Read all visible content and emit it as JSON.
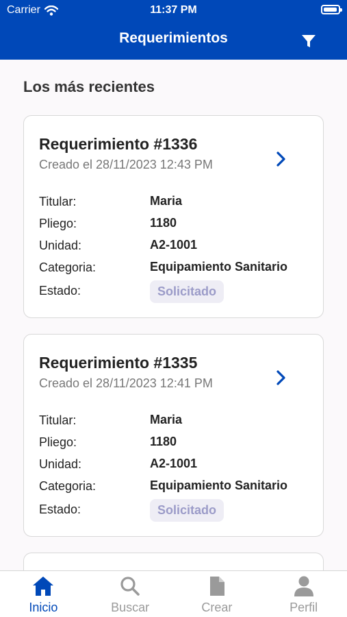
{
  "status_bar": {
    "carrier": "Carrier",
    "time": "11:37 PM",
    "battery_level": 0.95
  },
  "header": {
    "title": "Requerimientos"
  },
  "section_title": "Los más recientes",
  "field_labels": {
    "titular": "Titular:",
    "pliego": "Pliego:",
    "unidad": "Unidad:",
    "categoria": "Categoria:",
    "estado": "Estado:"
  },
  "cards": [
    {
      "title": "Requerimiento #1336",
      "created": "Creado el 28/11/2023 12:43 PM",
      "titular": "Maria",
      "pliego": "1180",
      "unidad": "A2-1001",
      "categoria": "Equipamiento Sanitario",
      "estado": "Solicitado"
    },
    {
      "title": "Requerimiento #1335",
      "created": "Creado el 28/11/2023 12:41 PM",
      "titular": "Maria",
      "pliego": "1180",
      "unidad": "A2-1001",
      "categoria": "Equipamiento Sanitario",
      "estado": "Solicitado"
    }
  ],
  "tabs": [
    {
      "label": "Inicio",
      "icon": "home-icon",
      "active": true
    },
    {
      "label": "Buscar",
      "icon": "search-icon",
      "active": false
    },
    {
      "label": "Crear",
      "icon": "document-icon",
      "active": false
    },
    {
      "label": "Perfil",
      "icon": "user-icon",
      "active": false
    }
  ],
  "colors": {
    "brand": "#0048b8",
    "badge_bg": "#eeedf5",
    "badge_text": "#9b9bc8",
    "inactive_tab": "#9a9a9a"
  }
}
